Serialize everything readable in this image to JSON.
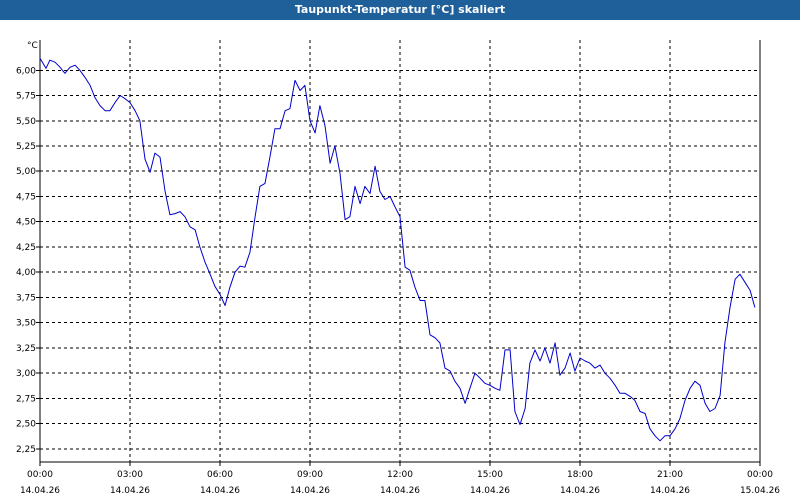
{
  "window": {
    "title": "Taupunkt-Temperatur [°C] skaliert"
  },
  "chart_data": {
    "type": "line",
    "title": "Taupunkt-Temperatur [°C] skaliert",
    "ylabel": "°C",
    "xlabel": "",
    "ylim": [
      2.12,
      6.3
    ],
    "xlim_hours": [
      0,
      24
    ],
    "grid": true,
    "grid_style": "dashed",
    "line_color": "#0000cc",
    "y_ticks": [
      "6,00",
      "5,75",
      "5,50",
      "5,25",
      "5,00",
      "4,75",
      "4,50",
      "4,25",
      "4,00",
      "3,75",
      "3,50",
      "3,25",
      "3,00",
      "2,75",
      "2,50",
      "2,25"
    ],
    "y_tick_values": [
      6.0,
      5.75,
      5.5,
      5.25,
      5.0,
      4.75,
      4.5,
      4.25,
      4.0,
      3.75,
      3.5,
      3.25,
      3.0,
      2.75,
      2.5,
      2.25
    ],
    "x_ticks": [
      {
        "time": "00:00",
        "date": "14.04.26"
      },
      {
        "time": "03:00",
        "date": "14.04.26"
      },
      {
        "time": "06:00",
        "date": "14.04.26"
      },
      {
        "time": "09:00",
        "date": "14.04.26"
      },
      {
        "time": "12:00",
        "date": "14.04.26"
      },
      {
        "time": "15:00",
        "date": "14.04.26"
      },
      {
        "time": "18:00",
        "date": "14.04.26"
      },
      {
        "time": "21:00",
        "date": "14.04.26"
      },
      {
        "time": "00:00",
        "date": "15.04.26"
      }
    ],
    "x_tick_hours": [
      0,
      3,
      6,
      9,
      12,
      15,
      18,
      21,
      24
    ],
    "series": [
      {
        "x_hours": [
          0,
          0.2,
          0.33,
          0.5,
          0.67,
          0.83,
          1.0,
          1.17,
          1.33,
          1.5,
          1.67,
          1.83,
          2.0,
          2.17,
          2.33,
          2.5,
          2.67,
          2.83,
          3.0,
          3.17,
          3.33,
          3.5,
          3.67,
          3.83,
          4.0,
          4.17,
          4.33,
          4.5,
          4.67,
          4.83,
          5.0,
          5.17,
          5.33,
          5.5,
          5.67,
          5.83,
          6.0,
          6.17,
          6.33,
          6.5,
          6.67,
          6.83,
          7.0,
          7.17,
          7.33,
          7.5,
          7.67,
          7.83,
          8.0,
          8.17,
          8.33,
          8.5,
          8.67,
          8.83,
          9.0,
          9.17,
          9.33,
          9.5,
          9.67,
          9.83,
          10.0,
          10.17,
          10.33,
          10.5,
          10.67,
          10.83,
          11.0,
          11.17,
          11.33,
          11.5,
          11.67,
          11.83,
          12.0,
          12.17,
          12.33,
          12.5,
          12.67,
          12.83,
          13.0,
          13.17,
          13.33,
          13.5,
          13.67,
          13.83,
          14.0,
          14.17,
          14.33,
          14.5,
          14.67,
          14.83,
          15.0,
          15.17,
          15.33,
          15.5,
          15.67,
          15.83,
          16.0,
          16.17,
          16.33,
          16.5,
          16.67,
          16.83,
          17.0,
          17.17,
          17.33,
          17.5,
          17.67,
          17.83,
          18.0,
          18.17,
          18.33,
          18.5,
          18.67,
          18.83,
          19.0,
          19.17,
          19.33,
          19.5,
          19.67,
          19.83,
          20.0,
          20.17,
          20.33,
          20.5,
          20.67,
          20.83,
          21.0,
          21.17,
          21.33,
          21.5,
          21.67,
          21.83,
          22.0,
          22.17,
          22.33,
          22.5,
          22.67,
          22.83,
          23.0,
          23.17,
          23.33,
          23.5,
          23.67,
          23.83,
          24.0
        ],
        "values": [
          6.12,
          6.02,
          6.1,
          6.08,
          6.03,
          5.97,
          6.03,
          6.05,
          6.0,
          5.93,
          5.85,
          5.73,
          5.65,
          5.6,
          5.6,
          5.68,
          5.75,
          5.72,
          5.68,
          5.6,
          5.5,
          5.12,
          4.99,
          5.18,
          5.14,
          4.8,
          4.57,
          4.58,
          4.6,
          4.55,
          4.45,
          4.42,
          4.25,
          4.1,
          3.98,
          3.86,
          3.78,
          3.67,
          3.85,
          4.0,
          4.06,
          4.05,
          4.2,
          4.55,
          4.85,
          4.88,
          5.15,
          5.42,
          5.42,
          5.6,
          5.62,
          5.9,
          5.8,
          5.85,
          5.5,
          5.38,
          5.65,
          5.45,
          5.08,
          5.25,
          4.98,
          4.52,
          4.55,
          4.85,
          4.68,
          4.85,
          4.78,
          5.05,
          4.8,
          4.72,
          4.75,
          4.65,
          4.55,
          4.05,
          4.02,
          3.85,
          3.72,
          3.72,
          3.38,
          3.35,
          3.3,
          3.05,
          3.02,
          2.92,
          2.85,
          2.7,
          2.85,
          3.0,
          2.95,
          2.9,
          2.88,
          2.85,
          2.83,
          3.23,
          3.23,
          2.62,
          2.49,
          2.65,
          3.1,
          3.23,
          3.12,
          3.25,
          3.1,
          3.3,
          2.98,
          3.05,
          3.2,
          3.02,
          3.15,
          3.12,
          3.1,
          3.05,
          3.08,
          3.0,
          2.95,
          2.88,
          2.8,
          2.8,
          2.77,
          2.73,
          2.62,
          2.6,
          2.45,
          2.38,
          2.33,
          2.38,
          2.38,
          2.45,
          2.55,
          2.73,
          2.85,
          2.92,
          2.88,
          2.7,
          2.62,
          2.65,
          2.78,
          3.3,
          3.65,
          3.93,
          3.98,
          3.9,
          3.82,
          3.65
        ]
      }
    ]
  }
}
